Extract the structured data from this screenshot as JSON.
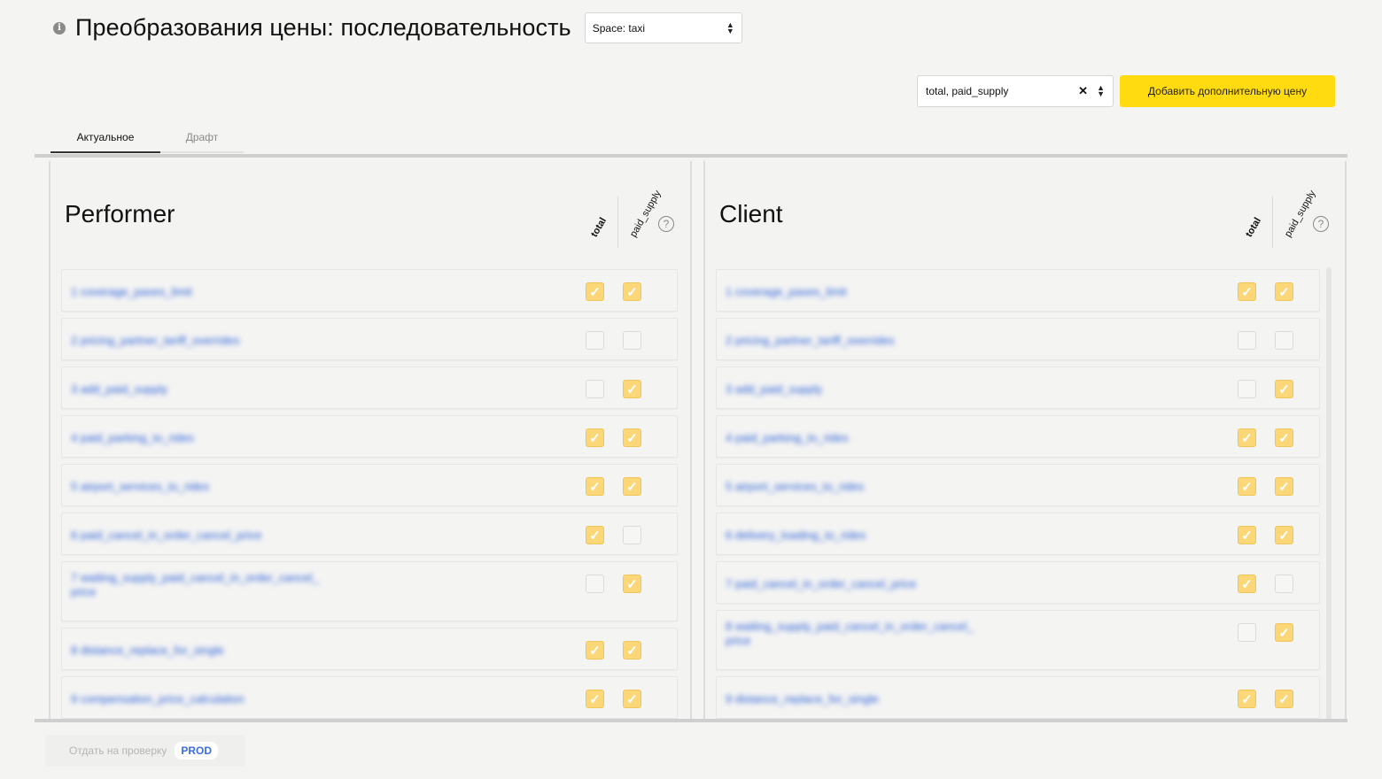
{
  "header": {
    "title": "Преобразования цены: последовательность",
    "space_select": "Space: taxi",
    "info_icon": "info-icon"
  },
  "toolbar": {
    "prices_value": "total, paid_supply",
    "add_button": "Добавить дополнительную цену"
  },
  "tabs": [
    {
      "label": "Актуальное",
      "active": true
    },
    {
      "label": "Драфт",
      "active": false
    }
  ],
  "panels": [
    {
      "title": "Performer",
      "columns": [
        "total",
        "paid_supply"
      ],
      "rows": [
        {
          "label": "1 coverage_paxes_limit",
          "total": true,
          "paid_supply": true
        },
        {
          "label": "2 pricing_partner_tariff_overrides",
          "total": false,
          "paid_supply": false
        },
        {
          "label": "3 add_paid_supply",
          "total": false,
          "paid_supply": true
        },
        {
          "label": "4 paid_parking_to_rides",
          "total": true,
          "paid_supply": true
        },
        {
          "label": "5 airport_services_to_rides",
          "total": true,
          "paid_supply": true
        },
        {
          "label": "6 paid_cancel_in_order_cancel_price",
          "total": true,
          "paid_supply": false
        },
        {
          "label": "7 waiting_supply_paid_cancel_in_order_cancel_price",
          "total": false,
          "paid_supply": true
        },
        {
          "label": "8 distance_replace_for_single",
          "total": true,
          "paid_supply": true
        },
        {
          "label": "9 compensation_price_calculation",
          "total": true,
          "paid_supply": true
        }
      ]
    },
    {
      "title": "Client",
      "columns": [
        "total",
        "paid_supply"
      ],
      "rows": [
        {
          "label": "1 coverage_paxes_limit",
          "total": true,
          "paid_supply": true
        },
        {
          "label": "2 pricing_partner_tariff_overrides",
          "total": false,
          "paid_supply": false
        },
        {
          "label": "3 add_paid_supply",
          "total": false,
          "paid_supply": true
        },
        {
          "label": "4 paid_parking_to_rides",
          "total": true,
          "paid_supply": true
        },
        {
          "label": "5 airport_services_to_rides",
          "total": true,
          "paid_supply": true
        },
        {
          "label": "6 delivery_loading_to_rides",
          "total": true,
          "paid_supply": true
        },
        {
          "label": "7 paid_cancel_in_order_cancel_price",
          "total": true,
          "paid_supply": false
        },
        {
          "label": "8 waiting_supply_paid_cancel_in_order_cancel_price",
          "total": false,
          "paid_supply": true
        },
        {
          "label": "9 distance_replace_for_single",
          "total": true,
          "paid_supply": true
        }
      ]
    }
  ],
  "footer": {
    "submit_label": "Отдать на проверку",
    "env_badge": "PROD"
  },
  "colors": {
    "accent_yellow": "#ffdb10",
    "checkbox_on": "#fbd778",
    "link_blue": "#2a5fd8",
    "badge_blue": "#3b6ee0"
  }
}
